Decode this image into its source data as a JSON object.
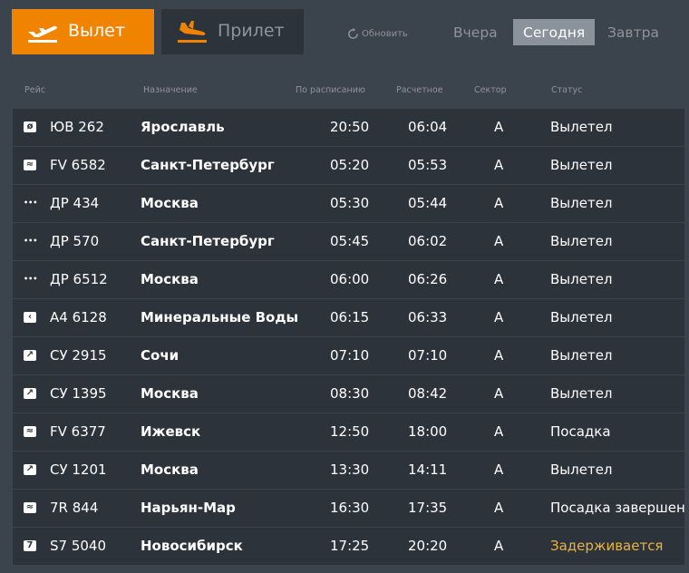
{
  "tabs": {
    "departures": "Вылет",
    "arrivals": "Прилет"
  },
  "refresh_label": "Обновить",
  "days": {
    "yesterday": "Вчера",
    "today": "Сегодня",
    "tomorrow": "Завтра"
  },
  "columns": {
    "flight": "Рейс",
    "destination": "Назначение",
    "scheduled": "По расписанию",
    "estimated": "Расчетное",
    "sector": "Сектор",
    "status": "Статус"
  },
  "colors": {
    "accent": "#f08300",
    "delayed": "#e8b343"
  },
  "flights": [
    {
      "flight": "ЮВ 262",
      "destination": "Ярославль",
      "scheduled": "20:50",
      "estimated": "06:04",
      "sector": "А",
      "status": "Вылетел",
      "airline_icon": "circle-slash-icon"
    },
    {
      "flight": "FV 6582",
      "destination": "Санкт-Петербург",
      "scheduled": "05:20",
      "estimated": "05:53",
      "sector": "А",
      "status": "Вылетел",
      "airline_icon": "swirl-icon"
    },
    {
      "flight": "ДР 434",
      "destination": "Москва",
      "scheduled": "05:30",
      "estimated": "05:44",
      "sector": "А",
      "status": "Вылетел",
      "airline_icon": "dots-icon"
    },
    {
      "flight": "ДР 570",
      "destination": "Санкт-Петербург",
      "scheduled": "05:45",
      "estimated": "06:02",
      "sector": "А",
      "status": "Вылетел",
      "airline_icon": "dots-icon"
    },
    {
      "flight": "ДР 6512",
      "destination": "Москва",
      "scheduled": "06:00",
      "estimated": "06:26",
      "sector": "А",
      "status": "Вылетел",
      "airline_icon": "dots-icon"
    },
    {
      "flight": "А4 6128",
      "destination": "Минеральные Воды",
      "scheduled": "06:15",
      "estimated": "06:33",
      "sector": "А",
      "status": "Вылетел",
      "airline_icon": "chevron-icon"
    },
    {
      "flight": "СУ 2915",
      "destination": "Сочи",
      "scheduled": "07:10",
      "estimated": "07:10",
      "sector": "А",
      "status": "Вылетел",
      "airline_icon": "wing-icon"
    },
    {
      "flight": "СУ 1395",
      "destination": "Москва",
      "scheduled": "08:30",
      "estimated": "08:42",
      "sector": "А",
      "status": "Вылетел",
      "airline_icon": "wing-icon"
    },
    {
      "flight": "FV 6377",
      "destination": "Ижевск",
      "scheduled": "12:50",
      "estimated": "18:00",
      "sector": "А",
      "status": "Посадка",
      "airline_icon": "swirl-icon"
    },
    {
      "flight": "СУ 1201",
      "destination": "Москва",
      "scheduled": "13:30",
      "estimated": "14:11",
      "sector": "А",
      "status": "Вылетел",
      "airline_icon": "wing-icon"
    },
    {
      "flight": "7R 844",
      "destination": "Нарьян-Мар",
      "scheduled": "16:30",
      "estimated": "17:35",
      "sector": "А",
      "status": "Посадка завершен",
      "airline_icon": "bird-icon"
    },
    {
      "flight": "S7 5040",
      "destination": "Новосибирск",
      "scheduled": "17:25",
      "estimated": "20:20",
      "sector": "А",
      "status": "Задерживается",
      "airline_icon": "s7-icon",
      "delayed": true
    }
  ]
}
